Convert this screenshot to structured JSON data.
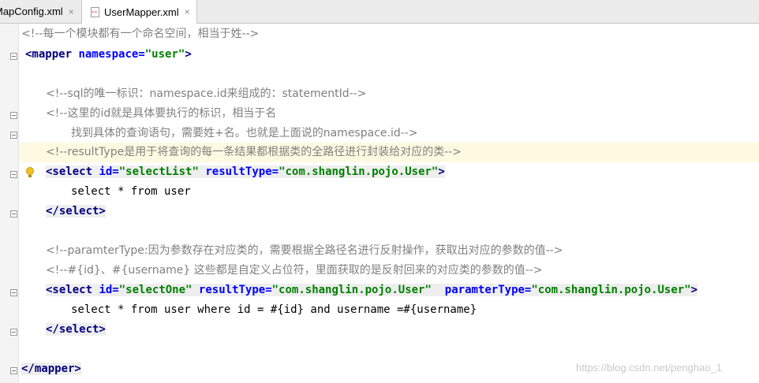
{
  "tabs": [
    {
      "label": "MapConfig.xml",
      "close": "×"
    },
    {
      "label": "UserMapper.xml",
      "close": "×"
    }
  ],
  "code": {
    "l1": "<!--每一个模块都有一个命名空间，相当于姓-->",
    "l2_open": "<mapper",
    "l2_attr": "namespace=",
    "l2_val": "\"user\"",
    "l2_close": ">",
    "l4": "<!--sql的唯一标识：namespace.id来组成的：statementId-->",
    "l5": "<!--这里的id就是具体要执行的标识，相当于名",
    "l6": "找到具体的查询语句，需要姓+名。也就是上面说的namespace.id-->",
    "l7": "<!--resultType是用于将查询的每一条结果都根据类的全路径进行封装给对应的类-->",
    "l8_open": "<select",
    "l8_attr1": "id=",
    "l8_val1": "\"selectList\"",
    "l8_attr2": "resultType=",
    "l8_val2": "\"com.shanglin.pojo.User\"",
    "l8_close": ">",
    "l9": "select * from user",
    "l10": "</select>",
    "l12": "<!--paramterType:因为参数存在对应类的，需要根据全路径名进行反射操作，获取出对应的参数的值-->",
    "l13": "<!--#{id}、#{username} 这些都是自定义占位符，里面获取的是反射回来的对应类的参数的值-->",
    "l14_open": "<select",
    "l14_attr1": "id=",
    "l14_val1": "\"selectOne\"",
    "l14_attr2": "resultType=",
    "l14_val2": "\"com.shanglin.pojo.User\"",
    "l14_attr3": "paramterType=",
    "l14_val3": "\"com.shanglin.pojo.User\"",
    "l14_close": ">",
    "l15": "select * from user where id = #{id} and username =#{username}",
    "l16": "</select>",
    "l18": "</mapper>"
  },
  "watermark": "https://blog.csdn.net/penghao_1",
  "colors": {
    "tag": "#000080",
    "attribute": "#0000ff",
    "value": "#008000",
    "comment": "#808080",
    "highlight_line": "#fefae1"
  },
  "icons": [
    "xml-file-icon",
    "fold-marker-icon",
    "intention-bulb-icon",
    "close-icon"
  ]
}
